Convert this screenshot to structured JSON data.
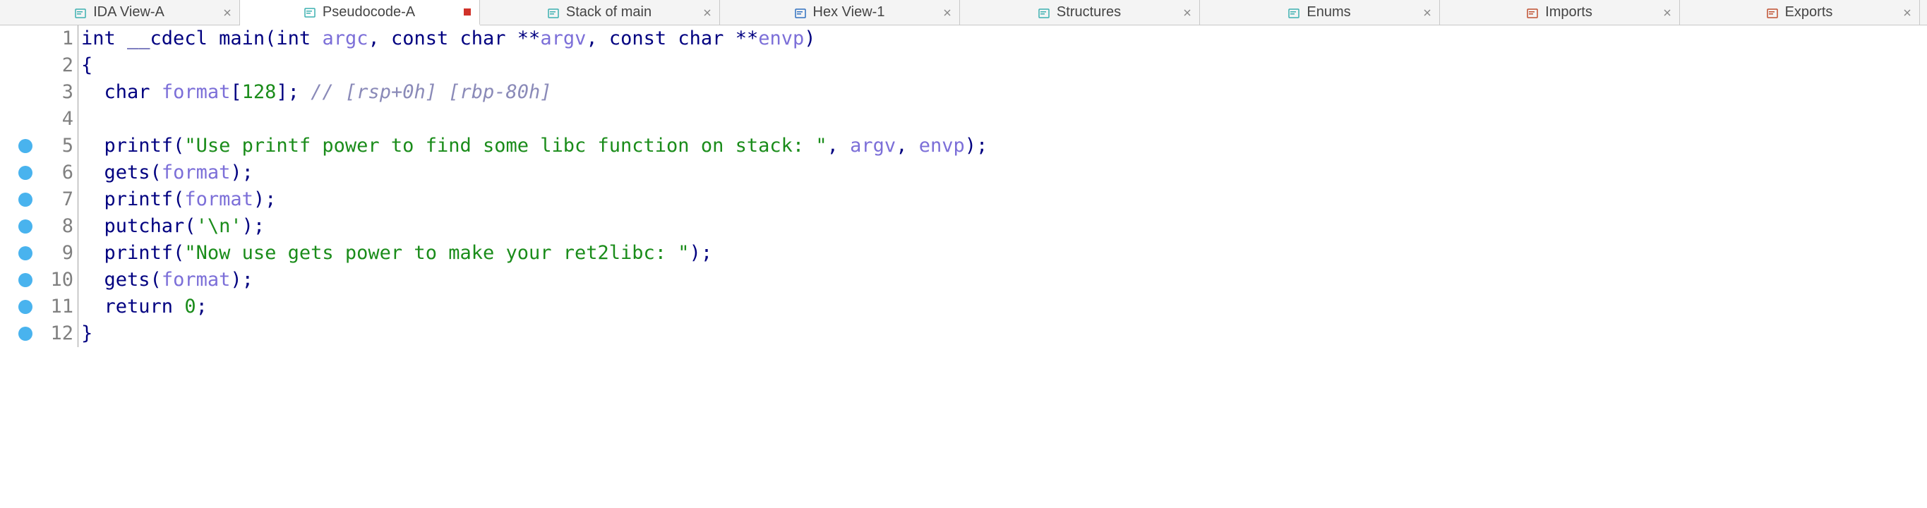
{
  "tabs": [
    {
      "label": "IDA View-A",
      "icon": "teal",
      "dirty": false
    },
    {
      "label": "Pseudocode-A",
      "icon": "teal",
      "dirty": true
    },
    {
      "label": "Stack of main",
      "icon": "teal",
      "dirty": false
    },
    {
      "label": "Hex View-1",
      "icon": "hex",
      "dirty": false
    },
    {
      "label": "Structures",
      "icon": "struct",
      "dirty": false
    },
    {
      "label": "Enums",
      "icon": "struct",
      "dirty": false
    },
    {
      "label": "Imports",
      "icon": "import",
      "dirty": false
    },
    {
      "label": "Exports",
      "icon": "export",
      "dirty": false
    }
  ],
  "active_tab_index": 1,
  "code": {
    "lines": [
      {
        "n": 1,
        "bp": false,
        "tokens": [
          {
            "t": "kw",
            "v": "int"
          },
          {
            "t": "plain",
            "v": " __cdecl "
          },
          {
            "t": "fn",
            "v": "main"
          },
          {
            "t": "punc",
            "v": "("
          },
          {
            "t": "kw",
            "v": "int"
          },
          {
            "t": "plain",
            "v": " "
          },
          {
            "t": "arg",
            "v": "argc"
          },
          {
            "t": "punc",
            "v": ", "
          },
          {
            "t": "kw",
            "v": "const char"
          },
          {
            "t": "plain",
            "v": " **"
          },
          {
            "t": "arg",
            "v": "argv"
          },
          {
            "t": "punc",
            "v": ", "
          },
          {
            "t": "kw",
            "v": "const char"
          },
          {
            "t": "plain",
            "v": " **"
          },
          {
            "t": "arg",
            "v": "envp"
          },
          {
            "t": "punc",
            "v": ")"
          }
        ]
      },
      {
        "n": 2,
        "bp": false,
        "tokens": [
          {
            "t": "punc",
            "v": "{"
          }
        ]
      },
      {
        "n": 3,
        "bp": false,
        "tokens": [
          {
            "t": "plain",
            "v": "  "
          },
          {
            "t": "kw",
            "v": "char"
          },
          {
            "t": "plain",
            "v": " "
          },
          {
            "t": "arg",
            "v": "format"
          },
          {
            "t": "punc",
            "v": "["
          },
          {
            "t": "num",
            "v": "128"
          },
          {
            "t": "punc",
            "v": "]; "
          },
          {
            "t": "cmt",
            "v": "// [rsp+0h] [rbp-80h]"
          }
        ]
      },
      {
        "n": 4,
        "bp": false,
        "tokens": []
      },
      {
        "n": 5,
        "bp": true,
        "tokens": [
          {
            "t": "plain",
            "v": "  "
          },
          {
            "t": "fn",
            "v": "printf"
          },
          {
            "t": "punc",
            "v": "("
          },
          {
            "t": "str",
            "v": "\"Use printf power to find some libc function on stack: \""
          },
          {
            "t": "punc",
            "v": ", "
          },
          {
            "t": "arg",
            "v": "argv"
          },
          {
            "t": "punc",
            "v": ", "
          },
          {
            "t": "arg",
            "v": "envp"
          },
          {
            "t": "punc",
            "v": ");"
          }
        ]
      },
      {
        "n": 6,
        "bp": true,
        "tokens": [
          {
            "t": "plain",
            "v": "  "
          },
          {
            "t": "fn",
            "v": "gets"
          },
          {
            "t": "punc",
            "v": "("
          },
          {
            "t": "arg",
            "v": "format"
          },
          {
            "t": "punc",
            "v": ");"
          }
        ]
      },
      {
        "n": 7,
        "bp": true,
        "tokens": [
          {
            "t": "plain",
            "v": "  "
          },
          {
            "t": "fn",
            "v": "printf"
          },
          {
            "t": "punc",
            "v": "("
          },
          {
            "t": "arg",
            "v": "format"
          },
          {
            "t": "punc",
            "v": ");"
          }
        ]
      },
      {
        "n": 8,
        "bp": true,
        "tokens": [
          {
            "t": "plain",
            "v": "  "
          },
          {
            "t": "fn",
            "v": "putchar"
          },
          {
            "t": "punc",
            "v": "("
          },
          {
            "t": "str",
            "v": "'\\n'"
          },
          {
            "t": "punc",
            "v": ");"
          }
        ]
      },
      {
        "n": 9,
        "bp": true,
        "tokens": [
          {
            "t": "plain",
            "v": "  "
          },
          {
            "t": "fn",
            "v": "printf"
          },
          {
            "t": "punc",
            "v": "("
          },
          {
            "t": "str",
            "v": "\"Now use gets power to make your ret2libc: \""
          },
          {
            "t": "punc",
            "v": ");"
          }
        ]
      },
      {
        "n": 10,
        "bp": true,
        "tokens": [
          {
            "t": "plain",
            "v": "  "
          },
          {
            "t": "fn",
            "v": "gets"
          },
          {
            "t": "punc",
            "v": "("
          },
          {
            "t": "arg",
            "v": "format"
          },
          {
            "t": "punc",
            "v": ");"
          }
        ]
      },
      {
        "n": 11,
        "bp": true,
        "tokens": [
          {
            "t": "plain",
            "v": "  "
          },
          {
            "t": "kw",
            "v": "return"
          },
          {
            "t": "plain",
            "v": " "
          },
          {
            "t": "num",
            "v": "0"
          },
          {
            "t": "punc",
            "v": ";"
          }
        ]
      },
      {
        "n": 12,
        "bp": true,
        "tokens": [
          {
            "t": "punc",
            "v": "}"
          }
        ]
      }
    ]
  },
  "icons": {
    "teal": "#3cb0b0",
    "hex": "#3070c0",
    "struct": "#3cb0b0",
    "import": "#c05030",
    "export": "#c05030"
  }
}
